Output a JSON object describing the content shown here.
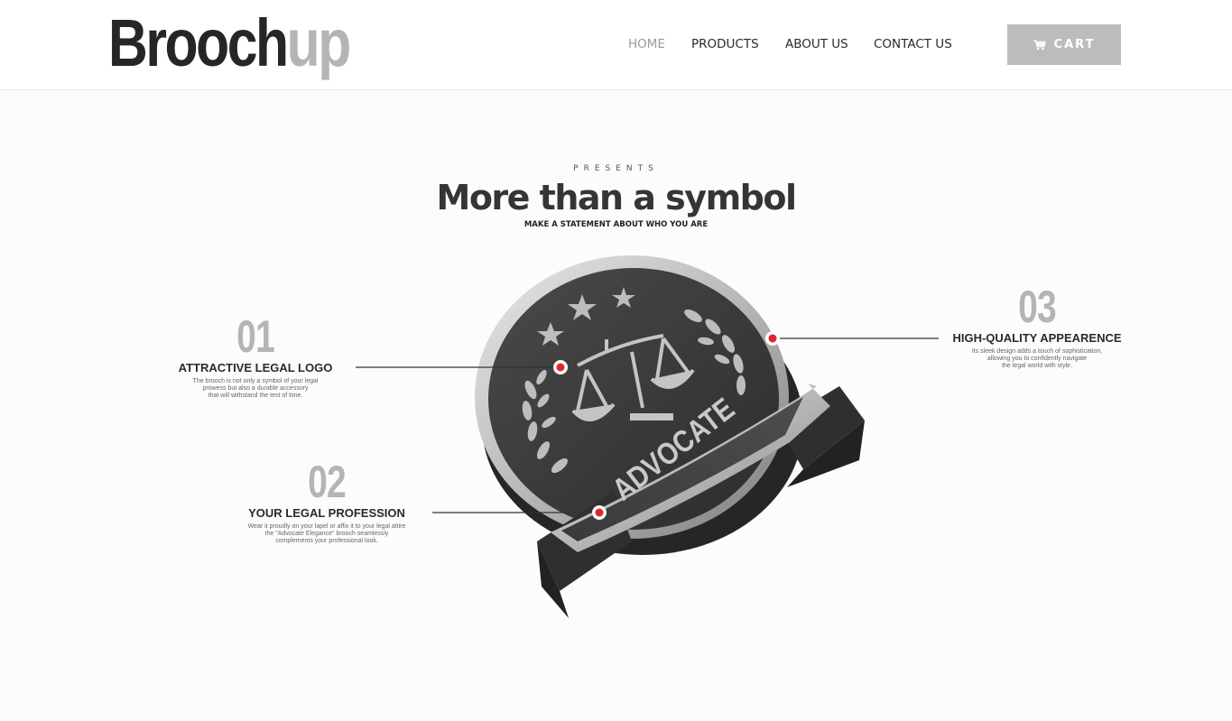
{
  "brand": {
    "logo_dark": "Brooch",
    "logo_light": "up",
    "dark_color": "#262626",
    "light_color": "#b5b5b5"
  },
  "nav": {
    "items": [
      {
        "label": "HOME",
        "active": true
      },
      {
        "label": "PRODUCTS",
        "active": false
      },
      {
        "label": "ABOUT US",
        "active": false
      },
      {
        "label": "CONTACT US",
        "active": false
      }
    ]
  },
  "cart": {
    "label": "CART",
    "icon": "cart-icon",
    "background": "#bcbcbc"
  },
  "hero": {
    "eyebrow": "PRESENTS",
    "title": "More than a symbol",
    "subtitle": "MAKE A STATEMENT ABOUT WHO YOU ARE"
  },
  "product": {
    "banner_text": "ADVOCATE"
  },
  "features": [
    {
      "number": "01",
      "title": "ATTRACTIVE LEGAL LOGO",
      "description": "The brooch is not only a symbol of your legal\nprowess but also a durable accessory\nthat will withstand the test of time."
    },
    {
      "number": "02",
      "title": "YOUR LEGAL PROFESSION",
      "description": "Wear it proudly on your lapel or affix it to your legal attire\nthe \"Advocate Elegance\" brooch seamlessly\ncomplements your professional look."
    },
    {
      "number": "03",
      "title": "HIGH-QUALITY APPEARENCE",
      "description": "Its sleek design adds a touch of sophistication,\nallowing you to confidently navigate\nthe legal world with style."
    }
  ],
  "colors": {
    "hotspot": "#e0262d",
    "accent_gray": "#b4b4b4"
  }
}
